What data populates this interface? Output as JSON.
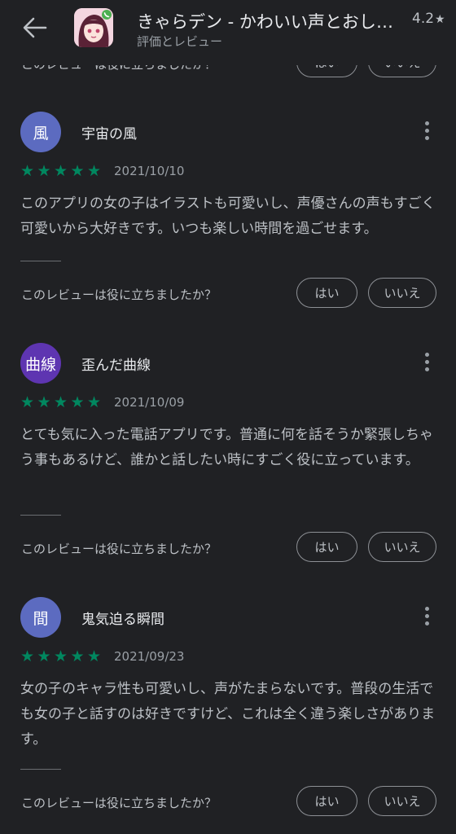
{
  "header": {
    "app_title": "きゃらデン - かわいい声とおしゃべり",
    "subtitle": "評価とレビュー",
    "rating": "4.2",
    "rating_star": "★"
  },
  "helpful": {
    "question": "このレビューは役に立ちましたか？",
    "yes": "はい",
    "no": "いいえ"
  },
  "reviews": [
    {
      "avatar_text": "風",
      "avatar_color": "#5c6bc0",
      "name": "宇宙の風",
      "rating": 5,
      "stars": "★★★★★",
      "date": "2021/10/10",
      "text": "このアプリの女の子はイラストも可愛いし、声優さんの声もすごく可愛いから大好きです。いつも楽しい時間を過ごせます。"
    },
    {
      "avatar_text": "曲線",
      "avatar_color": "#5e35b1",
      "name": "歪んだ曲線",
      "rating": 5,
      "stars": "★★★★★",
      "date": "2021/10/09",
      "text": "とても気に入った電話アプリです。普通に何を話そうか緊張しちゃう事もあるけど、誰かと話したい時にすごく役に立っています。"
    },
    {
      "avatar_text": "間",
      "avatar_color": "#5c6bc0",
      "name": "鬼気迫る瞬間",
      "rating": 5,
      "stars": "★★★★★",
      "date": "2021/09/23",
      "text": "女の子のキャラ性も可愛いし、声がたまらないです。普段の生活でも女の子と話すのは好きですけど、これは全く違う楽しさがあります。"
    }
  ],
  "icons": {
    "back": "arrow-back-icon",
    "more": "more-vert-icon",
    "app": "app-icon"
  },
  "colors": {
    "background": "#202124",
    "star_green": "#01875f"
  }
}
